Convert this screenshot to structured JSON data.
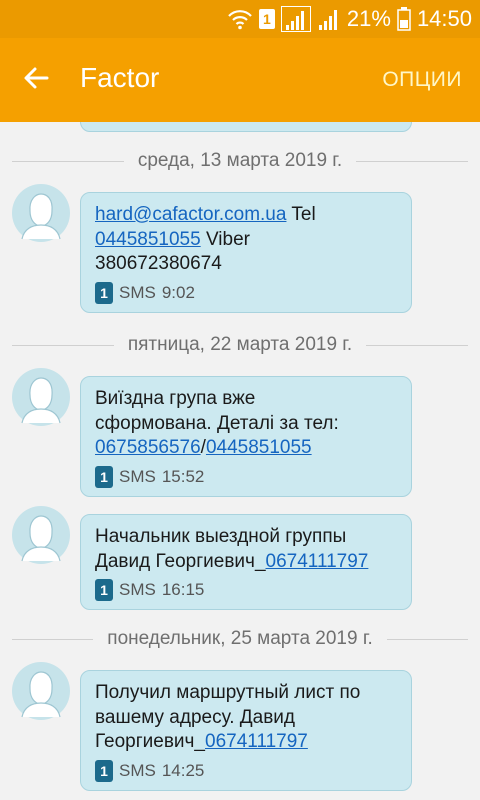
{
  "status_bar": {
    "sim_slot": "1",
    "battery_percent": "21%",
    "time": "14:50",
    "icons": [
      "wifi-icon",
      "sim-icon",
      "signal-icon",
      "signal-icon",
      "battery-icon"
    ]
  },
  "app_bar": {
    "title": "Factor",
    "options_label": "ОПЦИИ",
    "back_icon": "arrow-left-icon"
  },
  "colors": {
    "status_bar": "#eb9a00",
    "app_bar": "#f5a000",
    "bubble": "#cce9f0",
    "link": "#1565c0"
  },
  "conversation": {
    "dates": [
      "среда, 13 марта 2019 г.",
      "пятница, 22 марта 2019 г.",
      "понедельник, 25 марта 2019 г."
    ],
    "messages": [
      {
        "email": "hard@cafactor.com.ua",
        "tel_label": " Tel",
        "phone": "0445851055",
        "viber_label": " Viber",
        "viber_number": "380672380674",
        "sim": "1",
        "type": "SMS",
        "time": "9:02"
      },
      {
        "text_line1": "Виїздна група вже",
        "text_line2": "сформована. Деталі за тел:",
        "phone1": "0675856576",
        "separator": "/",
        "phone2": "0445851055",
        "sim": "1",
        "type": "SMS",
        "time": "15:52"
      },
      {
        "text_line1": "Начальник выездной группы",
        "text_line2": "Давид Георгиевич_",
        "phone": "0674111797",
        "sim": "1",
        "type": "SMS",
        "time": "16:15"
      },
      {
        "text_line1": "Получил маршрутный лист по",
        "text_line2": "вашему адресу. Давид",
        "text_line3": "Георгиевич_",
        "phone": "0674111797",
        "sim": "1",
        "type": "SMS",
        "time": "14:25"
      }
    ]
  }
}
